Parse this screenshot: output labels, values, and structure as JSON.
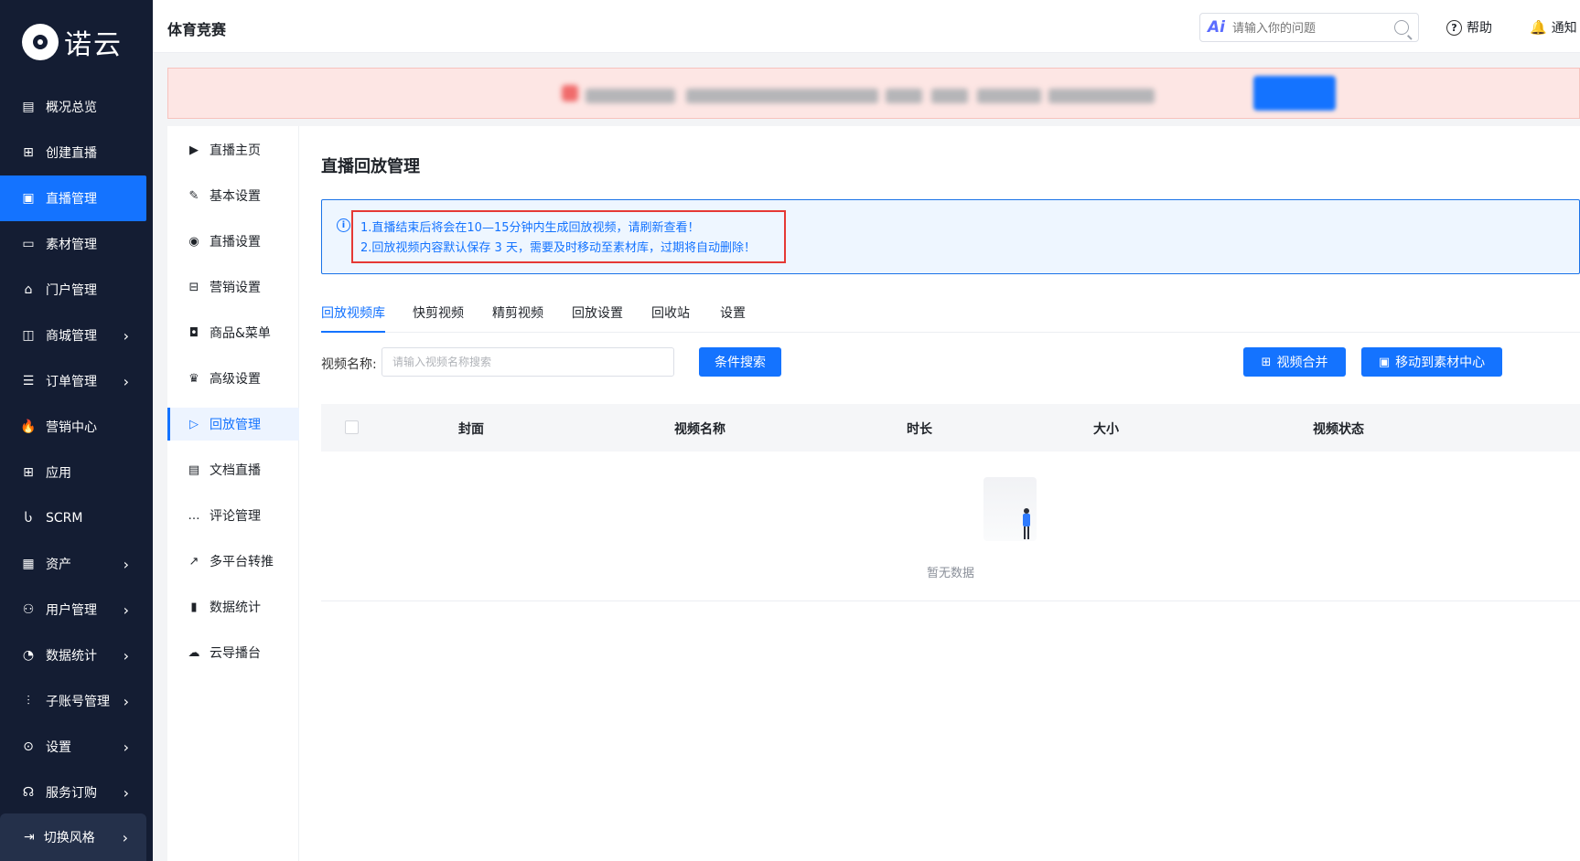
{
  "sidebar": {
    "logo_text": "诺云",
    "items": [
      {
        "label": "概况总览",
        "icon": "dashboard-icon",
        "chevron": false
      },
      {
        "label": "创建直播",
        "icon": "create-live-icon",
        "chevron": false
      },
      {
        "label": "直播管理",
        "icon": "live-manage-icon",
        "chevron": false,
        "active": true
      },
      {
        "label": "素材管理",
        "icon": "folder-icon",
        "chevron": false
      },
      {
        "label": "门户管理",
        "icon": "home-icon",
        "chevron": false
      },
      {
        "label": "商城管理",
        "icon": "shop-icon",
        "chevron": true
      },
      {
        "label": "订单管理",
        "icon": "order-icon",
        "chevron": true
      },
      {
        "label": "营销中心",
        "icon": "fire-icon",
        "chevron": false
      },
      {
        "label": "应用",
        "icon": "apps-icon",
        "chevron": false
      },
      {
        "label": "SCRM",
        "icon": "scrm-icon",
        "chevron": false
      },
      {
        "label": "资产",
        "icon": "assets-icon",
        "chevron": true
      },
      {
        "label": "用户管理",
        "icon": "user-icon",
        "chevron": true
      },
      {
        "label": "数据统计",
        "icon": "pie-chart-icon",
        "chevron": true
      },
      {
        "label": "子账号管理",
        "icon": "sub-account-icon",
        "chevron": true
      },
      {
        "label": "设置",
        "icon": "settings-icon",
        "chevron": true
      },
      {
        "label": "服务订购",
        "icon": "service-icon",
        "chevron": true
      }
    ],
    "theme_switch": "切换风格"
  },
  "header": {
    "title": "体育竞赛",
    "ai_badge": "Ai",
    "search_placeholder": "请输入你的问题",
    "help": "帮助",
    "notice": "通知"
  },
  "subnav": {
    "items": [
      {
        "label": "直播主页",
        "icon": "play-circle-icon"
      },
      {
        "label": "基本设置",
        "icon": "edit-icon"
      },
      {
        "label": "直播设置",
        "icon": "live-settings-icon"
      },
      {
        "label": "营销设置",
        "icon": "gift-icon"
      },
      {
        "label": "商品&菜单",
        "icon": "bag-icon"
      },
      {
        "label": "高级设置",
        "icon": "crown-icon"
      },
      {
        "label": "回放管理",
        "icon": "replay-icon",
        "active": true
      },
      {
        "label": "文档直播",
        "icon": "document-icon"
      },
      {
        "label": "评论管理",
        "icon": "comment-icon"
      },
      {
        "label": "多平台转推",
        "icon": "share-icon"
      },
      {
        "label": "数据统计",
        "icon": "bar-chart-icon"
      },
      {
        "label": "云导播台",
        "icon": "cloud-play-icon"
      }
    ]
  },
  "main": {
    "title": "直播回放管理",
    "tips": [
      "1.直播结束后将会在10—15分钟内生成回放视频，请刷新查看！",
      "2.回放视频内容默认保存 3 天，需要及时移动至素材库，过期将自动删除！"
    ],
    "tabs": [
      "回放视频库",
      "快剪视频",
      "精剪视频",
      "回放设置",
      "回收站",
      "设置"
    ],
    "filter_label": "视频名称:",
    "filter_placeholder": "请输入视频名称搜索",
    "search_button": "条件搜索",
    "merge_button": "视频合并",
    "move_button": "移动到素材中心",
    "columns": [
      "封面",
      "视频名称",
      "时长",
      "大小",
      "视频状态"
    ],
    "empty_text": "暂无数据"
  },
  "colors": {
    "primary": "#1473ff",
    "sidebar_bg": "#141d33",
    "highlight_border": "#e53935",
    "banner_bg": "#fde6e4"
  }
}
